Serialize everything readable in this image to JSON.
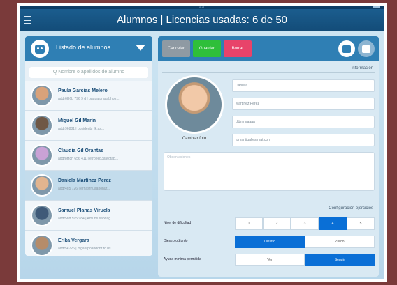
{
  "topbar": {
    "title": "Alumnos | Licencias usadas: 6 de 50"
  },
  "left_panel": {
    "title": "Listado de alumnos",
    "search_placeholder": "Q Nombre o apellidos de alumno",
    "students": [
      {
        "name": "Paula Garcias Melero",
        "sub": "addr6H6b 796 9 d | paupaturaaabhon...",
        "selected": false,
        "avatar_color": "#d9a27a"
      },
      {
        "name": "Miguel Gil Marín",
        "sub": "addr96881 | posidenbr Ik.as...",
        "selected": false,
        "avatar_color": "#6f5846"
      },
      {
        "name": "Claudia Gil Orantas",
        "sub": "addr8H8h 656 411 | etroeep3a9rotab...",
        "selected": false,
        "avatar_color": "#c9a2d6"
      },
      {
        "name": "Daniela Martínez Perez",
        "sub": "addr4d5 726 | ernasrnuaabonur...",
        "selected": true,
        "avatar_color": "#e1b48f"
      },
      {
        "name": "Samuel Planas Viruela",
        "sub": "addr5dd 595 984 | Amuns sabdag...",
        "selected": false,
        "avatar_color": "#3f5a78"
      },
      {
        "name": "Erika Vergara",
        "sub": "addr5e726 | mgaerpoabdonr fo.us...",
        "selected": false,
        "avatar_color": "#b58c6a"
      }
    ]
  },
  "right_panel": {
    "buttons": {
      "cancel": "Cancelar",
      "save": "Guardar",
      "delete": "Borrar"
    },
    "info_section": "Información",
    "photo_label": "Cambiar foto",
    "fields": [
      "Daniela",
      "Martínez Pérez",
      "dd/mm/aaaa",
      "tumantigallesrmat.com"
    ],
    "notes_placeholder": "Observaciones",
    "config_section": "Configuración ejercicios",
    "difficulty": {
      "label": "Nivel de dificultad",
      "options": [
        "1",
        "2",
        "3",
        "4",
        "5"
      ],
      "selected_index": 3
    },
    "hand": {
      "label": "Diestro o Zurdo",
      "options": [
        "Diestro",
        "Zurdo"
      ],
      "selected_index": 0
    },
    "rests": {
      "label": "Ayuda mínima permitida",
      "options": [
        "Ver",
        "Seguir"
      ],
      "selected_index": 1
    }
  }
}
